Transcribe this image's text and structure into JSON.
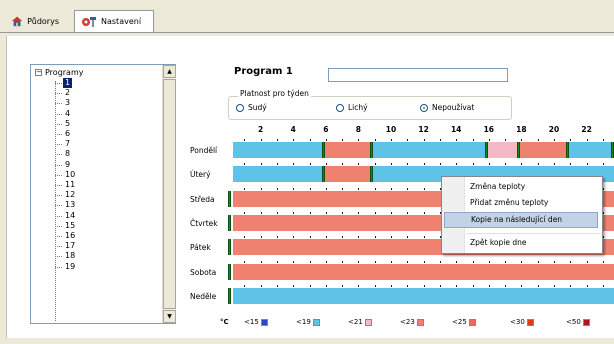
{
  "tabs": [
    {
      "label": "Půdorys",
      "icon": "house-icon",
      "active": false
    },
    {
      "label": "Nastavení",
      "icon": "settings-tools-icon",
      "active": true
    }
  ],
  "tree": {
    "root_label": "Programy",
    "selected": "1",
    "items": [
      "1",
      "2",
      "3",
      "4",
      "5",
      "6",
      "7",
      "8",
      "9",
      "10",
      "11",
      "12",
      "13",
      "14",
      "15",
      "16",
      "17",
      "18",
      "19"
    ]
  },
  "program": {
    "label": "Program 1",
    "name_value": ""
  },
  "week_parity": {
    "legend": "Platnost pro týden",
    "options": [
      "Sudý",
      "Lichý",
      "Nepoužívat"
    ],
    "selected": "Nepoužívat"
  },
  "schedule": {
    "hour_labels": [
      "2",
      "4",
      "6",
      "8",
      "10",
      "12",
      "14",
      "16",
      "18",
      "20",
      "22"
    ],
    "days": [
      {
        "name": "Pondělí",
        "segments": [
          [
            0,
            5.8,
            "c19"
          ],
          [
            5.8,
            8.8,
            "c23"
          ],
          [
            8.8,
            15.8,
            "c19"
          ],
          [
            15.8,
            17.8,
            "c21"
          ],
          [
            17.8,
            20.8,
            "c23"
          ],
          [
            20.8,
            23.8,
            "c19"
          ]
        ],
        "markers": [
          5.8,
          8.8,
          15.8,
          17.8,
          20.8,
          23.8
        ]
      },
      {
        "name": "Úterý",
        "segments": [
          [
            0,
            5.8,
            "c19"
          ],
          [
            5.8,
            8.8,
            "c23"
          ],
          [
            8.8,
            24,
            "c19"
          ]
        ],
        "markers": [
          5.8,
          8.8
        ]
      },
      {
        "name": "Středa",
        "segments": [
          [
            0,
            24,
            "c23"
          ]
        ],
        "markers": [
          0
        ]
      },
      {
        "name": "Čtvrtek",
        "segments": [
          [
            0,
            24,
            "c23"
          ]
        ],
        "markers": [
          0
        ]
      },
      {
        "name": "Pátek",
        "segments": [
          [
            0,
            24,
            "c23"
          ]
        ],
        "markers": [
          0
        ]
      },
      {
        "name": "Sobota",
        "segments": [
          [
            0,
            24,
            "c23"
          ]
        ],
        "markers": [
          0
        ]
      },
      {
        "name": "Neděle",
        "segments": [
          [
            0,
            24,
            "c19"
          ]
        ],
        "markers": [
          0
        ]
      }
    ]
  },
  "temperature_scale": {
    "unit": "°C",
    "items": [
      {
        "label": "<15",
        "color": "#1f4fbf"
      },
      {
        "label": "<19",
        "color": "#5ec3e6"
      },
      {
        "label": "<21",
        "color": "#f2b8c6"
      },
      {
        "label": "<23",
        "color": "#f08070"
      },
      {
        "label": "<25",
        "color": "#ef6a4f"
      },
      {
        "label": "<30",
        "color": "#e03a1e"
      },
      {
        "label": "<50",
        "color": "#b3141b"
      }
    ]
  },
  "colors": {
    "c19": "#5ec3e6",
    "c21": "#f2b8c6",
    "c23": "#f08070",
    "marker": "#138a1e",
    "tree_selection": "#0a246a",
    "menu_highlight": "#c3d3e6"
  },
  "context_menu": {
    "items": [
      {
        "label": "Změna teploty",
        "highlighted": false
      },
      {
        "label": "Přidat změnu teploty",
        "highlighted": false
      },
      {
        "label": "Kopie na následující den",
        "highlighted": true
      },
      {
        "label": "Zpět kopie dne",
        "highlighted": false
      }
    ]
  }
}
